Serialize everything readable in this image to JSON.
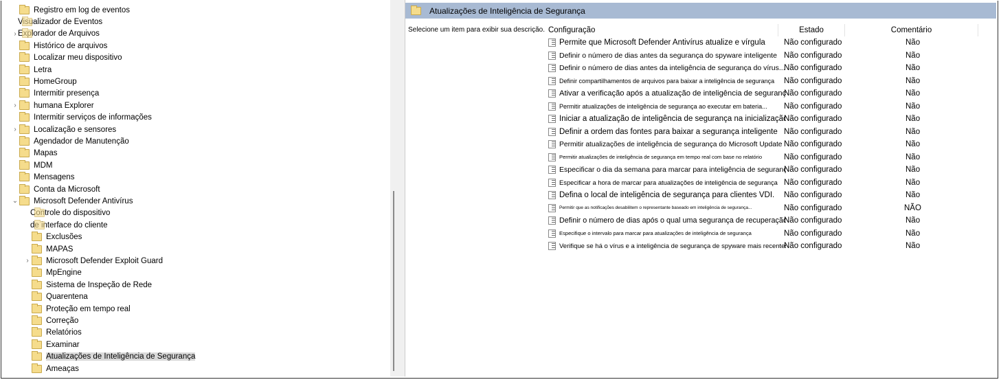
{
  "tree": [
    {
      "label": "Registro em log de eventos",
      "indent": 1,
      "chev": ""
    },
    {
      "label": "Visualizador de Eventos",
      "indent": 0,
      "chev": "",
      "overlap": true
    },
    {
      "label": "Explorador de Arquivos",
      "indent": 0,
      "chev": "›",
      "overlap": true
    },
    {
      "label": "Histórico de arquivos",
      "indent": 1,
      "chev": ""
    },
    {
      "label": "Localizar meu dispositivo",
      "indent": 1,
      "chev": ""
    },
    {
      "label": "Letra",
      "indent": 1,
      "chev": ""
    },
    {
      "label": "HomeGroup",
      "indent": 1,
      "chev": ""
    },
    {
      "label": "Intermitir presença",
      "indent": 1,
      "chev": ""
    },
    {
      "label": "humana Explorer",
      "indent": 1,
      "chev": "›"
    },
    {
      "label": "Intermitir serviços de informações",
      "indent": 1,
      "chev": ""
    },
    {
      "label": "Localização e sensores",
      "indent": 1,
      "chev": "›"
    },
    {
      "label": "Agendador de Manutenção",
      "indent": 1,
      "chev": ""
    },
    {
      "label": "Mapas",
      "indent": 1,
      "chev": ""
    },
    {
      "label": "MDM",
      "indent": 1,
      "chev": ""
    },
    {
      "label": "Mensagens",
      "indent": 1,
      "chev": ""
    },
    {
      "label": "Conta da Microsoft",
      "indent": 1,
      "chev": ""
    },
    {
      "label": "Microsoft Defender Antivírus",
      "indent": 1,
      "chev": "⌄"
    },
    {
      "label": "Controle do dispositivo",
      "indent": 2,
      "chev": "",
      "overlap": true
    },
    {
      "label": "de interface do cliente",
      "indent": 2,
      "chev": "",
      "overlap": true
    },
    {
      "label": "Exclusões",
      "indent": 2,
      "chev": ""
    },
    {
      "label": "MAPAS",
      "indent": 2,
      "chev": ""
    },
    {
      "label": "Microsoft Defender Exploit Guard",
      "indent": 2,
      "chev": "›"
    },
    {
      "label": "MpEngine",
      "indent": 2,
      "chev": ""
    },
    {
      "label": "Sistema de Inspeção de Rede",
      "indent": 2,
      "chev": ""
    },
    {
      "label": "Quarentena",
      "indent": 2,
      "chev": ""
    },
    {
      "label": "Proteção em tempo real",
      "indent": 2,
      "chev": ""
    },
    {
      "label": "Correção",
      "indent": 2,
      "chev": ""
    },
    {
      "label": "Relatórios",
      "indent": 2,
      "chev": ""
    },
    {
      "label": "Examinar",
      "indent": 2,
      "chev": ""
    },
    {
      "label": "Atualizações de Inteligência de Segurança",
      "indent": 2,
      "chev": "",
      "selected": true
    },
    {
      "label": "Ameaças",
      "indent": 2,
      "chev": ""
    }
  ],
  "pane": {
    "title": "Atualizações de Inteligência de Segurança",
    "description": "Selecione um item para exibir sua descrição.",
    "columns": {
      "config": "Configuração",
      "state": "Estado",
      "comment": "Comentário"
    },
    "rows": [
      {
        "c": "Permite que Microsoft Defender Antivírus atualize e vírgula",
        "s": "Não configurado",
        "m": "Não",
        "f": 11.5
      },
      {
        "c": "Definir o número de dias antes da segurança do spyware inteligente",
        "s": "Não configurado",
        "m": "Não",
        "f": 10.5
      },
      {
        "c": "Definir o número de dias antes da inteligência de segurança do vírus...",
        "s": "Não configurado",
        "m": "Não",
        "f": 10.5
      },
      {
        "c": "Definir compartilhamentos de arquivos para baixar a inteligência de segurança",
        "s": "Não configurado",
        "m": "Não",
        "f": 9
      },
      {
        "c": "Ativar a verificação após a atualização de inteligência de segurança",
        "s": "Não configurado",
        "m": "Não",
        "f": 11.2
      },
      {
        "c": "Permitir atualizações de inteligência de segurança ao executar em bateria...",
        "s": "Não configurado",
        "m": "Não",
        "f": 9
      },
      {
        "c": "Iniciar a atualização de inteligência de segurança na inicialização",
        "s": "Não configurado",
        "m": "Não",
        "f": 11.5
      },
      {
        "c": "Definir a ordem das fontes para baixar a segurança inteligente",
        "s": "Não configurado",
        "m": "Não",
        "f": 11.5
      },
      {
        "c": "Permitir atualizações de inteligência de segurança do Microsoft Update",
        "s": "Não configurado",
        "m": "Não",
        "f": 10.3
      },
      {
        "c": "Permitir atualizações de inteligência de segurança em tempo real com base no relatório",
        "s": "Não configurado",
        "m": "Não",
        "f": 7.6
      },
      {
        "c": "Especificar o dia da semana para marcar para inteligência de segurança",
        "s": "Não configurado",
        "m": "Não",
        "f": 10.5
      },
      {
        "c": "Especificar a hora de marcar para atualizações de inteligência de segurança",
        "s": "Não configurado",
        "m": "Não",
        "f": 9.4
      },
      {
        "c": "Defina o local de inteligência de segurança para clientes VDI.",
        "s": "Não configurado",
        "m": "Não",
        "f": 11.5
      },
      {
        "c": "Permitir que as notificações desabilitem o representante baseado em inteligência de segurança...",
        "s": "Não configurado",
        "m": "NÃO",
        "f": 6.5
      },
      {
        "c": "Definir o número de dias após o qual uma segurança de recuperação",
        "s": "Não configurado",
        "m": "Não",
        "f": 10.8
      },
      {
        "c": "Especifique o intervalo para marcar para atualizações de inteligência de segurança",
        "s": "Não configurado",
        "m": "Não",
        "f": 7.6
      },
      {
        "c": "Verifique se há o vírus e a inteligência de segurança de spyware mais recentes...",
        "s": "Não configurado",
        "m": "Não",
        "f": 9.5
      }
    ]
  },
  "colors": {
    "header": "#a8bad3",
    "selected": "#d9d9d9"
  }
}
